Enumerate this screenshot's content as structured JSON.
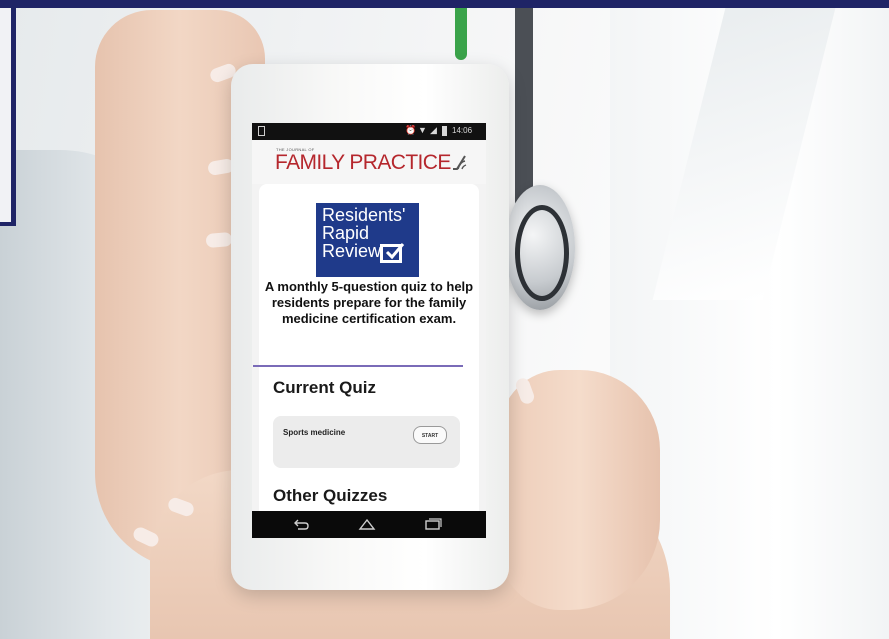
{
  "status_bar": {
    "time": "14:06",
    "icons": [
      "sim-icon",
      "alarm-icon",
      "wifi-icon",
      "signal-icon",
      "battery-icon"
    ]
  },
  "masthead": {
    "prefix": "THE JOURNAL OF",
    "title": "FAMILY PRACTICE",
    "icon": "signal-waves-icon"
  },
  "logo": {
    "line1": "Residents'",
    "line2": "Rapid",
    "line3": "Review",
    "icon": "checkbox-icon"
  },
  "description": "A monthly 5-question quiz to help residents prepare for the family medicine certification exam.",
  "current_quiz": {
    "heading": "Current Quiz",
    "items": [
      {
        "name": "Sports medicine",
        "button": "START"
      }
    ]
  },
  "other_quizzes": {
    "heading": "Other Quizzes"
  },
  "nav_bar": {
    "icons": [
      "back-icon",
      "home-icon",
      "recents-icon"
    ]
  },
  "colors": {
    "brand_navy": "#1f2466",
    "masthead_red": "#b5272d",
    "logo_blue": "#1f3a8a",
    "divider_purple": "#7a6bb8"
  }
}
